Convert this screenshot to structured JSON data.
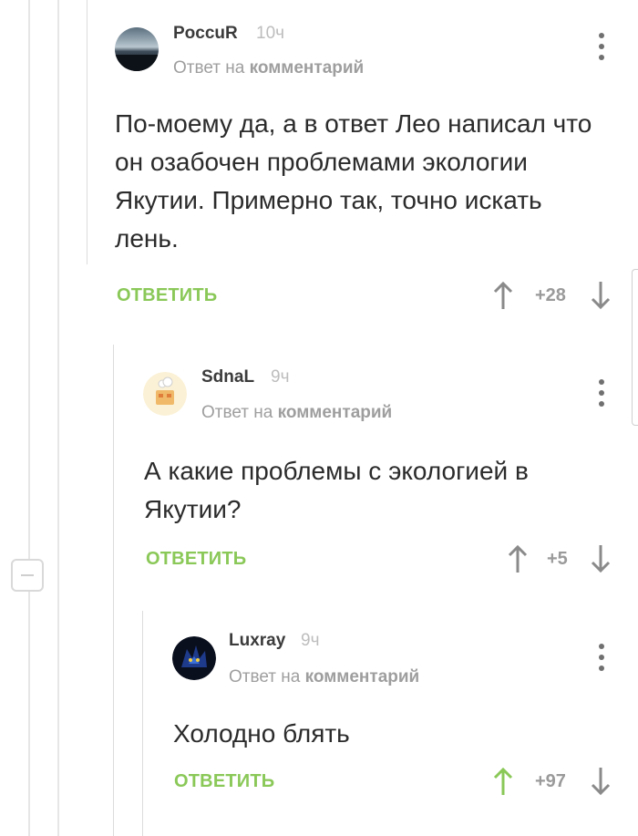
{
  "thread": {
    "comments": [
      {
        "username": "PoccuR",
        "time": "10ч",
        "reply_prefix": "Ответ на",
        "reply_target": "комментарий",
        "text": "По-моему да, а в ответ Лео написал что он озабочен проблемами экологии Якутии. Примерно так, точно искать лень.",
        "reply_label": "ОТВЕТИТЬ",
        "rating": "+28",
        "upvoted": false
      },
      {
        "username": "SdnaL",
        "time": "9ч",
        "reply_prefix": "Ответ на",
        "reply_target": "комментарий",
        "text": "А какие проблемы с экологией в Якутии?",
        "reply_label": "ОТВЕТИТЬ",
        "rating": "+5",
        "upvoted": false
      },
      {
        "username": "Luxray",
        "time": "9ч",
        "reply_prefix": "Ответ на",
        "reply_target": "комментарий",
        "text": "Холодно блять",
        "reply_label": "ОТВЕТИТЬ",
        "rating": "+97",
        "upvoted": true
      }
    ]
  },
  "icons": {
    "up": "arrow-up-icon",
    "down": "arrow-down-icon",
    "menu": "more-vertical-icon",
    "collapse": "collapse-minus-icon"
  },
  "colors": {
    "accent_green": "#8ac858",
    "vote_neutral": "#8a8a8a",
    "text_main": "#2b2b2b",
    "meta_gray": "#9e9e9e"
  }
}
